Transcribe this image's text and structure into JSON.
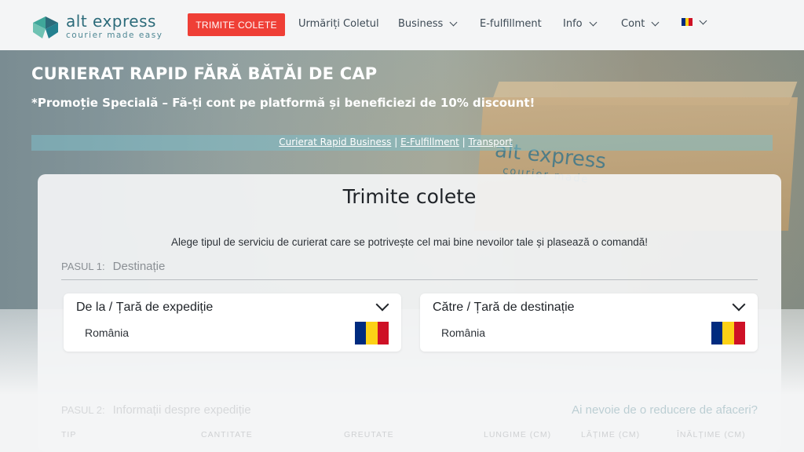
{
  "brand": {
    "name": "alt express",
    "tagline": "courier made easy",
    "accent": "#ef3f36",
    "primary": "#2c6b7a"
  },
  "nav": {
    "cta": "TRIMITE COLETE",
    "items": [
      {
        "label": "Urmăriți Coletul",
        "dropdown": false
      },
      {
        "label": "Business",
        "dropdown": true
      },
      {
        "label": "E-fulfillment",
        "dropdown": false
      },
      {
        "label": "Info",
        "dropdown": true
      },
      {
        "label": "Cont",
        "dropdown": true
      }
    ],
    "language_icon": "flag-romania-icon"
  },
  "hero": {
    "title": "CURIERAT RAPID FĂRĂ BĂTĂI DE CAP",
    "promo": "*Promoție Specială – Fă-ți cont pe platformă și beneficiezi de 10% discount!",
    "links": [
      "Curierat Rapid Business",
      "E-Fulfillment",
      "Transport"
    ],
    "box_brand": "alt express",
    "box_tagline": "courier made"
  },
  "form": {
    "title": "Trimite colete",
    "subtitle": "Alege tipul de serviciu de curierat care se potrivește cel mai bine nevoilor tale și plasează o comandă!",
    "step1": {
      "prefix": "PASUL 1:",
      "name": "Destinație"
    },
    "from": {
      "label": "De la / Țară de expediție",
      "value": "România"
    },
    "to": {
      "label": "Către / Țară de destinație",
      "value": "România"
    },
    "step2": {
      "prefix": "PASUL 2:",
      "name": "Informații despre expediție"
    },
    "discount_link": "Ai nevoie de o reducere de afaceri?",
    "columns": [
      "TIP",
      "CANTITATE",
      "GREUTATE",
      "LUNGIME (CM)",
      "LĂȚIME (CM)",
      "ÎNĂLȚIME (CM)"
    ]
  },
  "flag_colors": [
    "#002b7f",
    "#fcd116",
    "#ce1126"
  ]
}
